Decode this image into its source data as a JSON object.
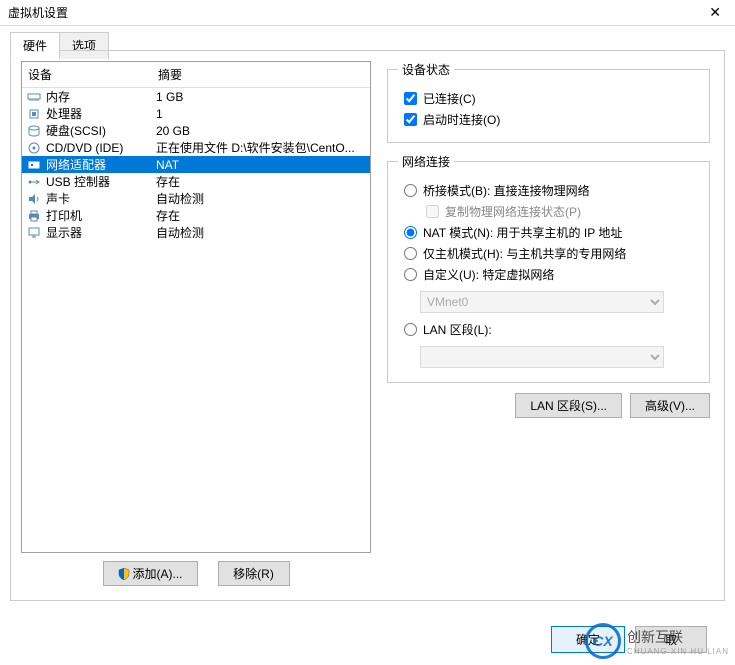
{
  "window": {
    "title": "虚拟机设置",
    "close_label": "✕"
  },
  "tabs": {
    "hardware": "硬件",
    "options": "选项"
  },
  "headers": {
    "device": "设备",
    "summary": "摘要"
  },
  "devices": [
    {
      "icon": "memory",
      "name": "内存",
      "summary": "1 GB",
      "selected": false
    },
    {
      "icon": "cpu",
      "name": "处理器",
      "summary": "1",
      "selected": false
    },
    {
      "icon": "disk",
      "name": "硬盘(SCSI)",
      "summary": "20 GB",
      "selected": false
    },
    {
      "icon": "cd",
      "name": "CD/DVD (IDE)",
      "summary": "正在使用文件 D:\\软件安装包\\CentO...",
      "selected": false
    },
    {
      "icon": "network",
      "name": "网络适配器",
      "summary": "NAT",
      "selected": true
    },
    {
      "icon": "usb",
      "name": "USB 控制器",
      "summary": "存在",
      "selected": false
    },
    {
      "icon": "sound",
      "name": "声卡",
      "summary": "自动检测",
      "selected": false
    },
    {
      "icon": "printer",
      "name": "打印机",
      "summary": "存在",
      "selected": false
    },
    {
      "icon": "display",
      "name": "显示器",
      "summary": "自动检测",
      "selected": false
    }
  ],
  "left_buttons": {
    "add": "添加(A)...",
    "remove": "移除(R)"
  },
  "device_status": {
    "legend": "设备状态",
    "connected": "已连接(C)",
    "connect_at_poweron": "启动时连接(O)"
  },
  "network_connection": {
    "legend": "网络连接",
    "bridged": "桥接模式(B): 直接连接物理网络",
    "replicate": "复制物理网络连接状态(P)",
    "nat": "NAT 模式(N): 用于共享主机的 IP 地址",
    "hostonly": "仅主机模式(H): 与主机共享的专用网络",
    "custom": "自定义(U): 特定虚拟网络",
    "custom_value": "VMnet0",
    "lan_segment": "LAN 区段(L):",
    "lan_value": ""
  },
  "right_buttons": {
    "lan_segments": "LAN 区段(S)...",
    "advanced": "高级(V)..."
  },
  "bottom": {
    "ok": "确定",
    "cancel": "取"
  },
  "watermark": {
    "logo": "CX",
    "text": "创新互联",
    "sub": "CHUANG XIN HU LIAN"
  }
}
